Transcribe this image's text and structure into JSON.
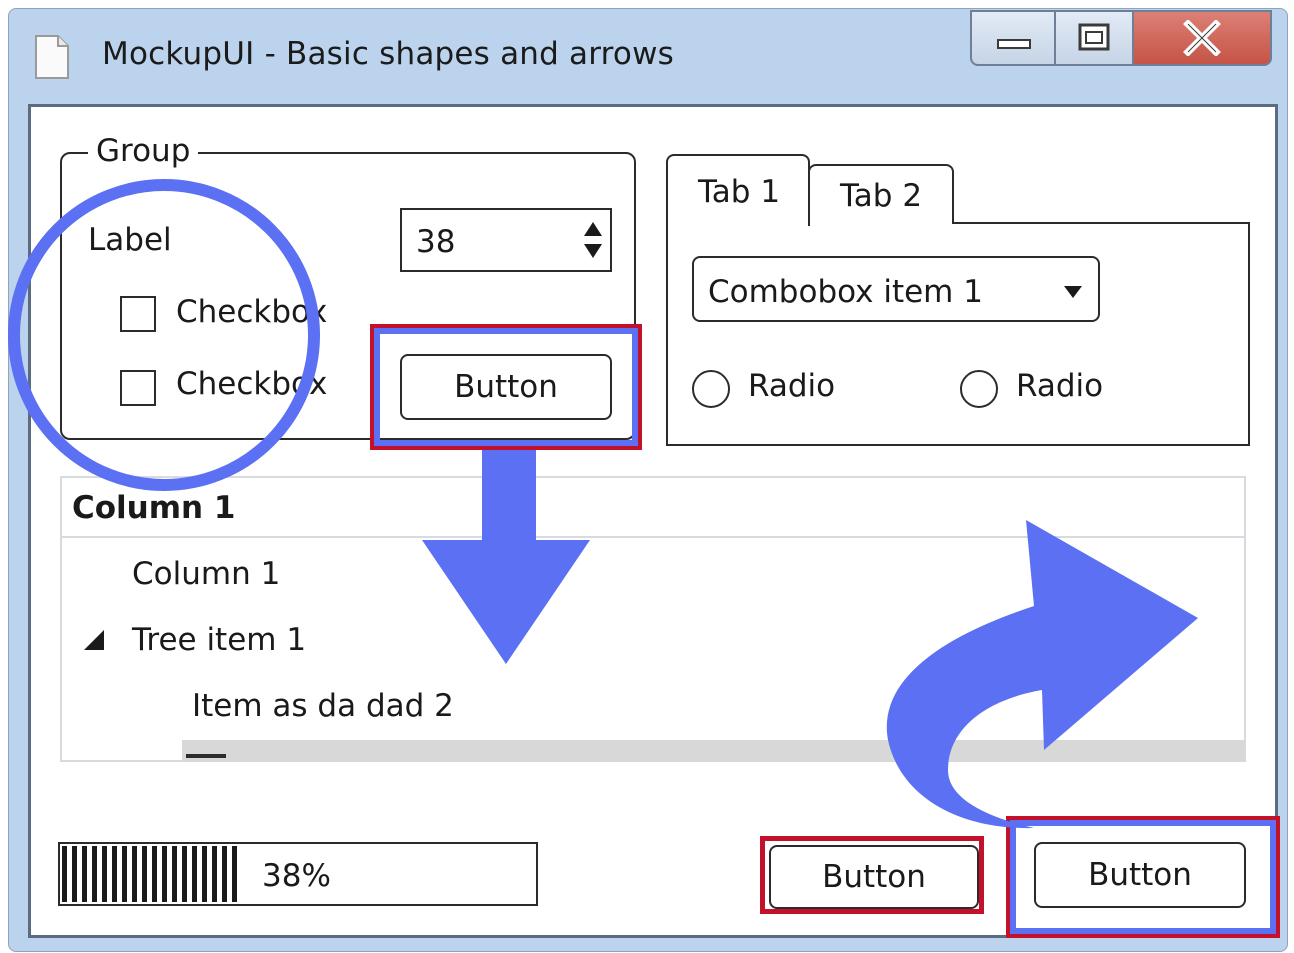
{
  "window": {
    "title": "MockupUI - Basic shapes and arrows",
    "icons": [
      "document-icon",
      "minimize-icon",
      "maximize-icon",
      "close-icon"
    ],
    "colors": {
      "frame": "#bcd3ee",
      "close": "#c55346",
      "highlight_blue": "#5b70f2",
      "highlight_red": "#c4112b"
    }
  },
  "group": {
    "title": "Group",
    "label": "Label",
    "checkboxes": [
      {
        "label": "Checkbox",
        "checked": false
      },
      {
        "label": "Checkbox",
        "checked": false
      }
    ],
    "spinner_value": "38",
    "button_label": "Button"
  },
  "tabs": {
    "items": [
      {
        "label": "Tab 1",
        "active": true
      },
      {
        "label": "Tab 2",
        "active": false
      }
    ],
    "combobox_value": "Combobox item 1",
    "radios": [
      {
        "label": "Radio",
        "selected": false
      },
      {
        "label": "Radio",
        "selected": false
      }
    ]
  },
  "tree": {
    "header": "Column 1",
    "rows": [
      {
        "text": "Column 1",
        "level": 1
      },
      {
        "text": "Tree item 1",
        "level": 1,
        "expanded": true
      },
      {
        "text": "Item as da dad 2",
        "level": 2
      }
    ]
  },
  "progress": {
    "value": 0.38,
    "label": "38%"
  },
  "footer": {
    "button_left": "Button",
    "button_right": "Button"
  }
}
